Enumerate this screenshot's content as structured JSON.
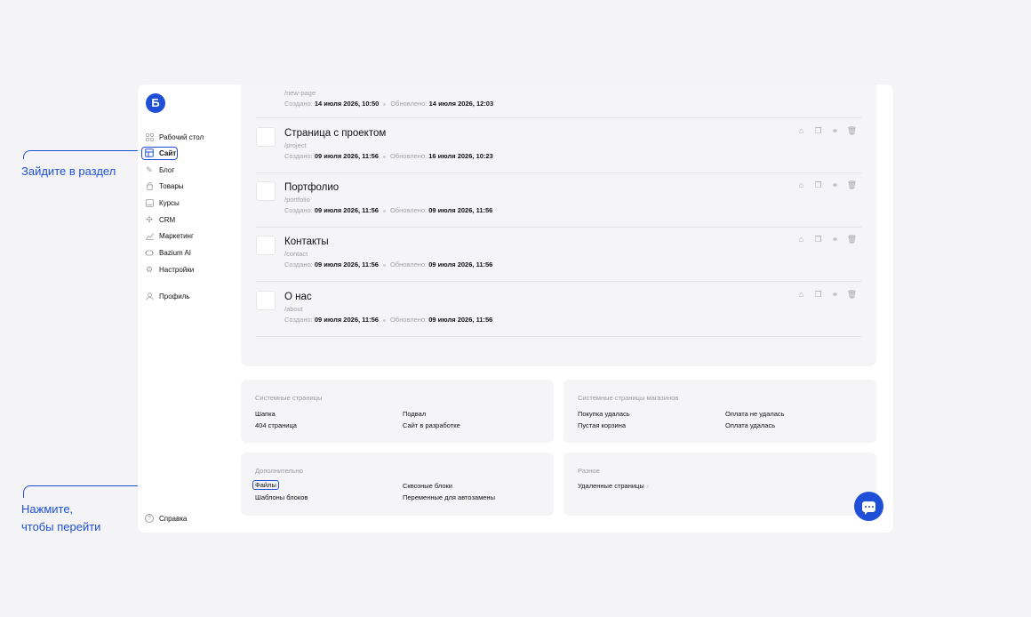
{
  "logo": {
    "letter": "Б"
  },
  "sidebar": {
    "items": [
      {
        "label": "Рабочий стол",
        "icon": "grid-icon"
      },
      {
        "label": "Сайт",
        "icon": "layout-icon",
        "active": true
      },
      {
        "label": "Блог",
        "icon": "pen-icon"
      },
      {
        "label": "Товары",
        "icon": "bag-icon"
      },
      {
        "label": "Курсы",
        "icon": "book-icon"
      },
      {
        "label": "CRM",
        "icon": "network-icon"
      },
      {
        "label": "Маркетинг",
        "icon": "chart-icon"
      },
      {
        "label": "Bazium AI",
        "icon": "ai-icon"
      },
      {
        "label": "Настройки",
        "icon": "gear-icon"
      },
      {
        "label": "Профиль",
        "icon": "user-icon"
      }
    ],
    "help": "Справка"
  },
  "pages": {
    "partial_row": {
      "slug": "/new-page",
      "created_label": "Создано:",
      "created": "14 июля 2026, 10:50",
      "updated_label": "Обновлено:",
      "updated": "14 июля 2026, 12:03"
    },
    "rows": [
      {
        "title": "Страница с проектом",
        "slug": "/project",
        "created_label": "Создано:",
        "created": "09 июля 2026, 11:56",
        "updated_label": "Обновлено:",
        "updated": "16 июля 2026, 10:23"
      },
      {
        "title": "Портфолио",
        "slug": "/portfolio",
        "created_label": "Создано:",
        "created": "09 июля 2026, 11:56",
        "updated_label": "Обновлено:",
        "updated": "09 июля 2026, 11:56"
      },
      {
        "title": "Контакты",
        "slug": "/contact",
        "created_label": "Создано:",
        "created": "09 июля 2026, 11:56",
        "updated_label": "Обновлено:",
        "updated": "09 июля 2026, 11:56"
      },
      {
        "title": "О нас",
        "slug": "/about",
        "created_label": "Создано:",
        "created": "09 июля 2026, 11:56",
        "updated_label": "Обновлено:",
        "updated": "09 июля 2026, 11:56"
      }
    ],
    "actions": [
      "home-icon",
      "copy-icon",
      "link-icon",
      "trash-icon"
    ]
  },
  "system_pages": {
    "title": "Системные страницы",
    "links": [
      "Шапка",
      "Подвал",
      "404 страница",
      "Сайт в разработке"
    ]
  },
  "shop_pages": {
    "title": "Системные страницы магазинов",
    "links": [
      "Покупка удалась",
      "Оплата не удалась",
      "Пустая корзина",
      "Оплата удалась"
    ]
  },
  "extra": {
    "title": "Дополнительно",
    "links": [
      "Файлы",
      "Сквозные блоки",
      "Шаблоны блоков",
      "Переменные для автозамены"
    ]
  },
  "misc": {
    "title": "Разное",
    "links": [
      "Удаленные страницы"
    ]
  },
  "annotations": {
    "go_to_section": "Зайдите в раздел",
    "click_line1": "Нажмите,",
    "click_line2": "чтобы перейти"
  },
  "colors": {
    "accent": "#1f4fd6",
    "panel": "#f5f5f7",
    "muted": "#a1a1a8"
  }
}
